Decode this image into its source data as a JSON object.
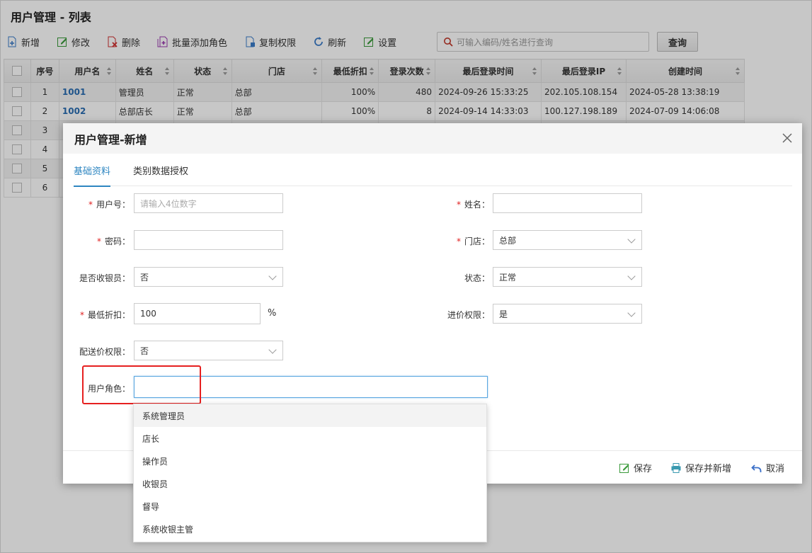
{
  "page": {
    "title": "用户管理 - 列表"
  },
  "toolbar": {
    "add": "新增",
    "edit": "修改",
    "delete": "删除",
    "batch_role": "批量添加角色",
    "copy_perm": "复制权限",
    "refresh": "刷新",
    "settings": "设置",
    "search_placeholder": "可输入编码/姓名进行查询",
    "query": "查询"
  },
  "grid": {
    "headers": [
      "序号",
      "用户名",
      "姓名",
      "状态",
      "门店",
      "最低折扣",
      "登录次数",
      "最后登录时间",
      "最后登录IP",
      "创建时间"
    ],
    "rows": [
      {
        "idx": "1",
        "user": "1001",
        "name": "管理员",
        "status": "正常",
        "store": "总部",
        "discount": "100%",
        "logins": "480",
        "last_time": "2024-09-26 15:33:25",
        "last_ip": "202.105.108.154",
        "created": "2024-05-28 13:38:19"
      },
      {
        "idx": "2",
        "user": "1002",
        "name": "总部店长",
        "status": "正常",
        "store": "总部",
        "discount": "100%",
        "logins": "8",
        "last_time": "2024-09-14 14:33:03",
        "last_ip": "100.127.198.189",
        "created": "2024-07-09 14:06:08"
      },
      {
        "idx": "3"
      },
      {
        "idx": "4"
      },
      {
        "idx": "5"
      },
      {
        "idx": "6"
      }
    ]
  },
  "modal": {
    "title": "用户管理-新增",
    "tabs": [
      "基础资料",
      "类别数据授权"
    ],
    "required_mark": "*",
    "labels": {
      "user_no": "用户号：",
      "name": "姓名：",
      "password": "密码：",
      "store": "门店：",
      "is_cashier": "是否收银员：",
      "status": "状态：",
      "min_discount": "最低折扣：",
      "purchase_perm": "进价权限：",
      "delivery_perm": "配送价权限：",
      "user_role": "用户角色："
    },
    "values": {
      "user_no_placeholder": "请输入4位数字",
      "name": "",
      "password": "",
      "store": "总部",
      "is_cashier": "否",
      "status": "正常",
      "min_discount": "100",
      "discount_unit": "%",
      "purchase_perm": "是",
      "delivery_perm": "否",
      "user_role": ""
    },
    "footer": {
      "save": "保存",
      "save_new": "保存并新增",
      "cancel": "取消"
    }
  },
  "dropdown": {
    "options": [
      "系统管理员",
      "店长",
      "操作员",
      "收银员",
      "督导",
      "系统收银主管"
    ]
  },
  "colors": {
    "accent": "#2e86c1",
    "required": "#e02020",
    "highlight": "#e62020",
    "link": "#2a6db2"
  }
}
